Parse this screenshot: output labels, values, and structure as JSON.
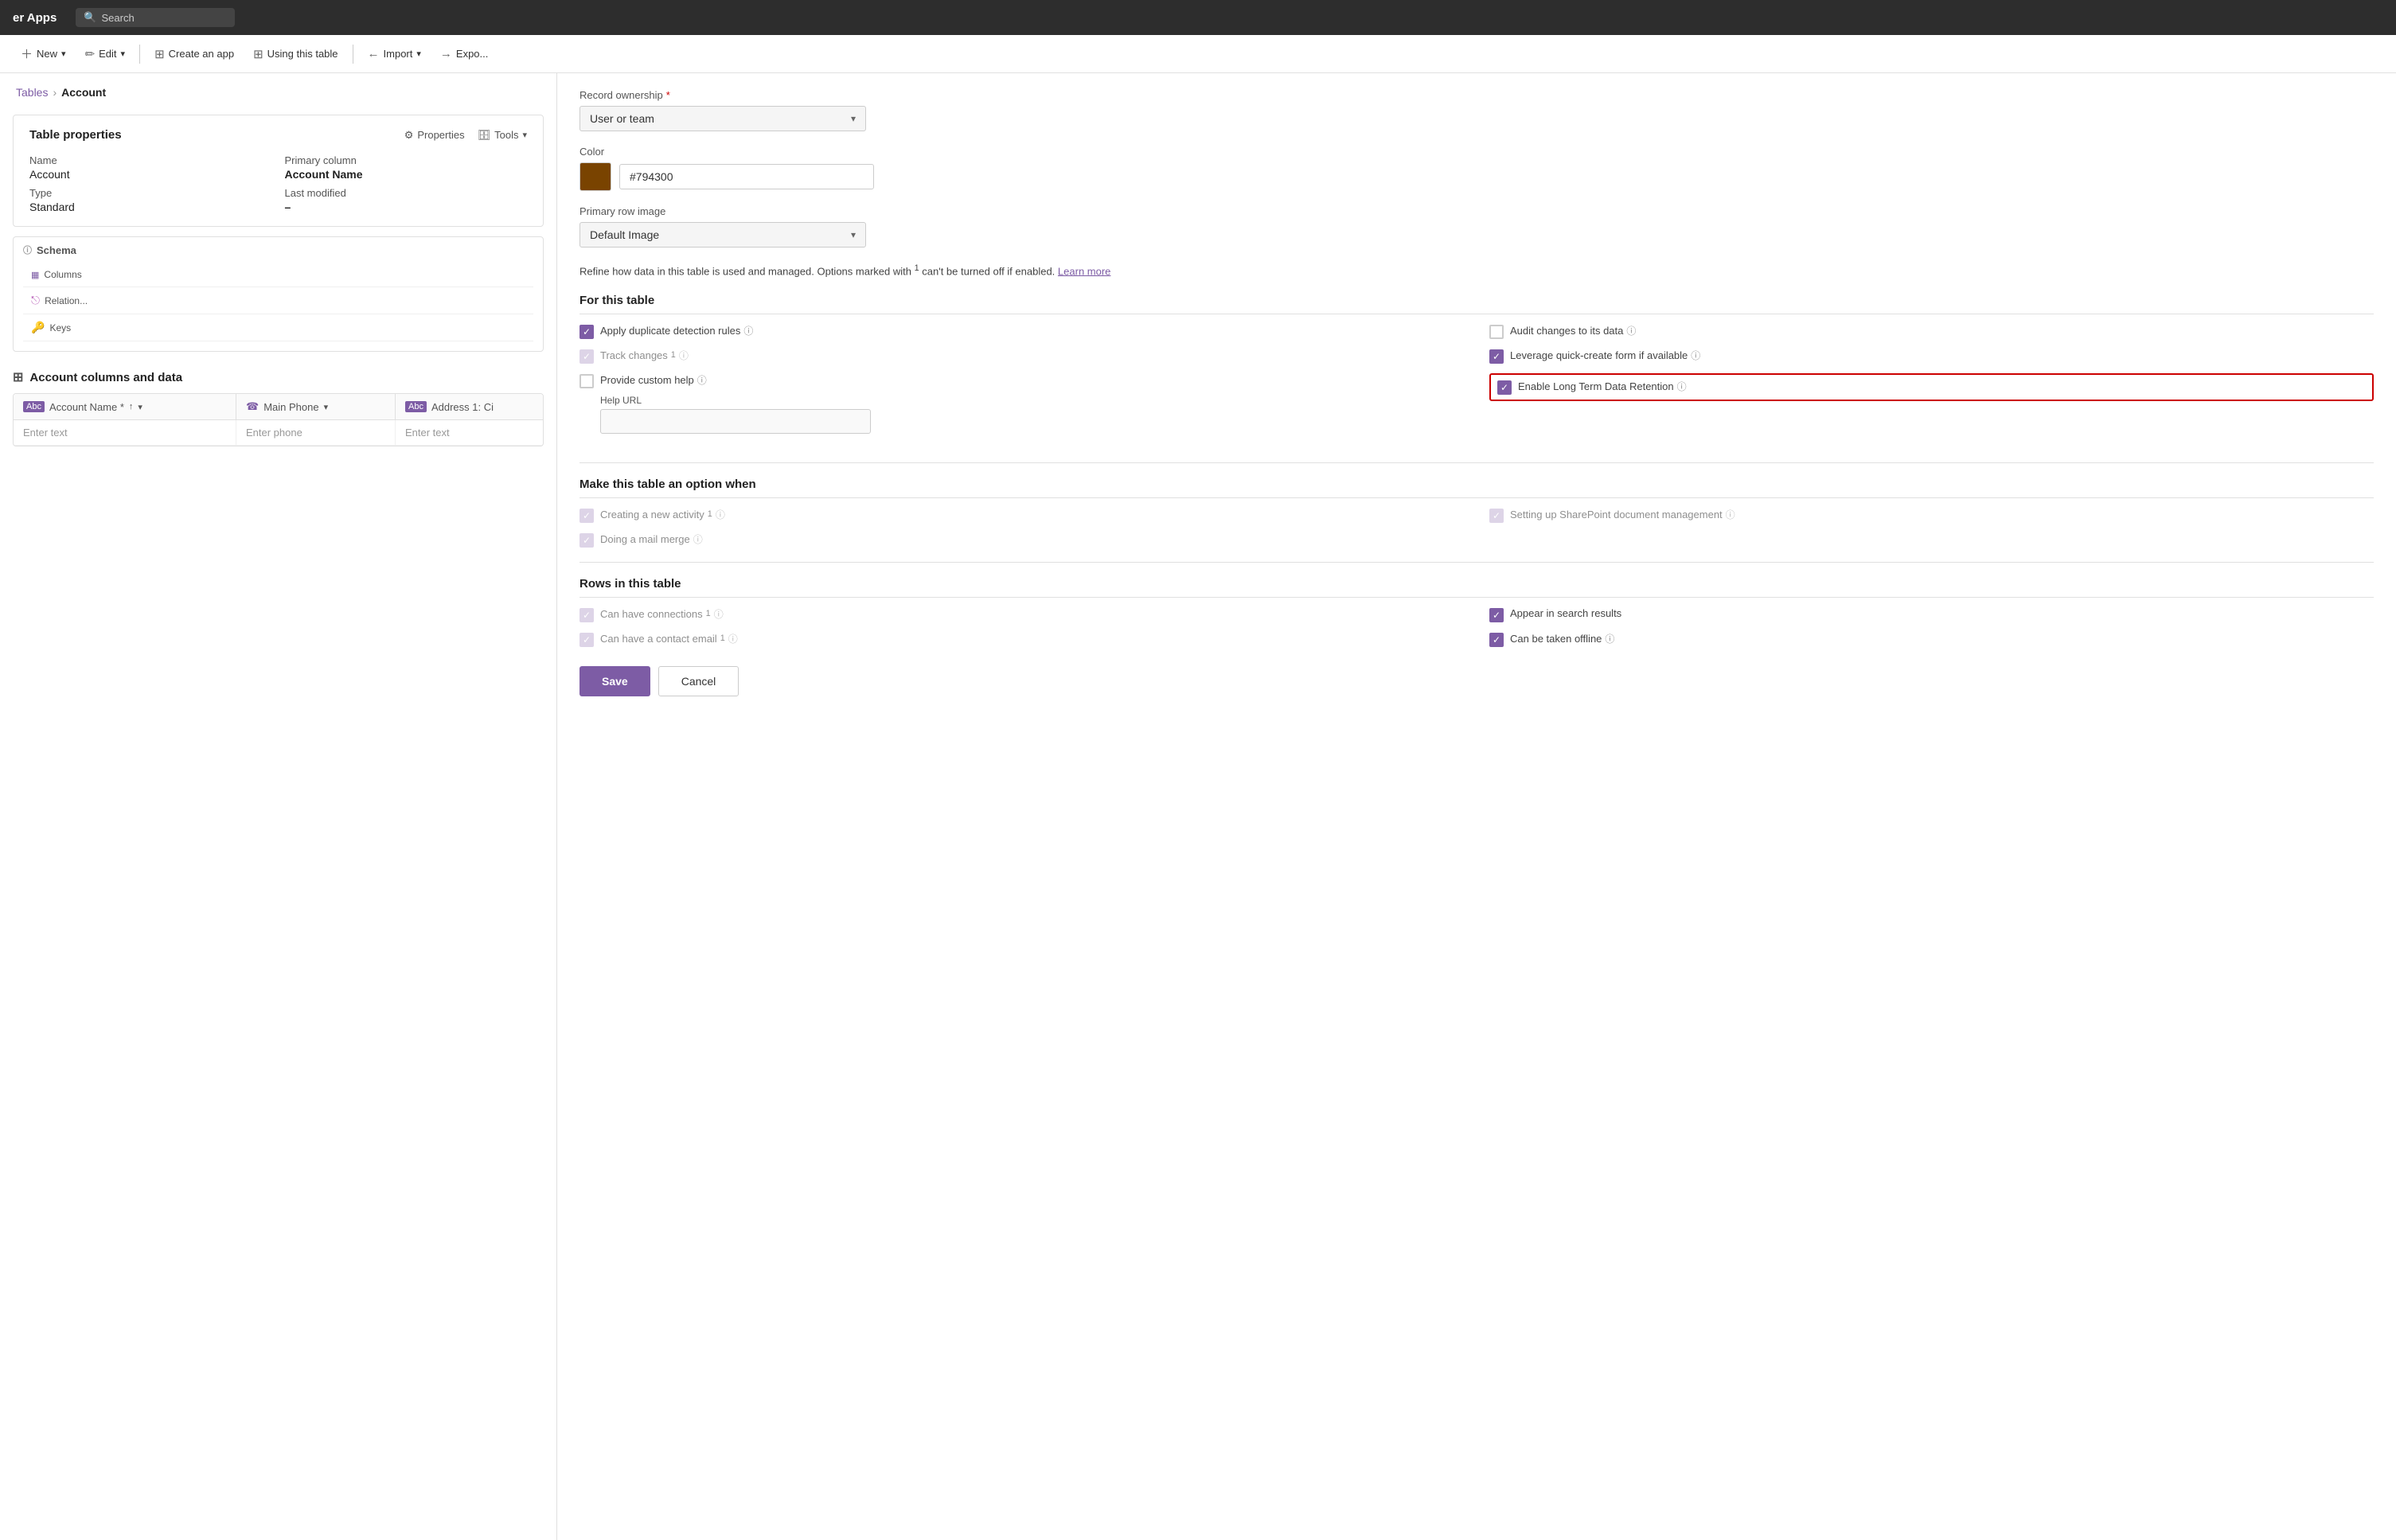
{
  "app": {
    "title": "er Apps",
    "search_placeholder": "Search"
  },
  "toolbar": {
    "new_label": "New",
    "edit_label": "Edit",
    "create_app_label": "Create an app",
    "using_table_label": "Using this table",
    "import_label": "Import",
    "export_label": "Expo..."
  },
  "breadcrumb": {
    "parent": "Tables",
    "separator": "›",
    "current": "Account"
  },
  "table_properties": {
    "title": "Table properties",
    "properties_btn": "Properties",
    "tools_btn": "Tools",
    "name_label": "Name",
    "name_value": "Account",
    "primary_col_label": "Primary column",
    "primary_col_value": "Account Name",
    "type_label": "Type",
    "type_value": "Standard",
    "last_modified_label": "Last modified",
    "last_modified_value": "–"
  },
  "schema": {
    "title": "Schema",
    "columns_label": "Columns",
    "relationships_label": "Relation...",
    "keys_label": "Keys"
  },
  "data_section": {
    "title": "Account columns and data",
    "columns": [
      {
        "icon": "Abc",
        "label": "Account Name",
        "required": true,
        "sort": true,
        "filter": true
      },
      {
        "icon": "☎",
        "label": "Main Phone",
        "filter": true
      },
      {
        "icon": "Abc",
        "label": "Address 1: Ci",
        "filter": false
      }
    ],
    "rows": [
      {
        "account_name_placeholder": "Enter text",
        "main_phone_placeholder": "Enter phone",
        "address_placeholder": "Enter text"
      }
    ]
  },
  "right_panel": {
    "record_ownership_label": "Record ownership",
    "record_ownership_required": true,
    "record_ownership_value": "User or team",
    "color_label": "Color",
    "color_value": "#794300",
    "color_hex": "#794300",
    "primary_row_image_label": "Primary row image",
    "primary_row_image_value": "Default Image",
    "refine_text": "Refine how data in this table is used and managed. Options marked with",
    "refine_superscript": "1",
    "refine_text2": "can't be turned off if enabled.",
    "learn_more": "Learn more",
    "for_this_table": {
      "title": "For this table",
      "checkboxes": [
        {
          "id": "apply_dup",
          "label": "Apply duplicate detection rules",
          "info": true,
          "checked": true,
          "disabled": false
        },
        {
          "id": "audit_changes",
          "label": "Audit changes to its data",
          "info": true,
          "checked": false,
          "disabled": false
        },
        {
          "id": "track_changes",
          "label": "Track changes",
          "superscript": "1",
          "info": true,
          "checked": true,
          "disabled": true
        },
        {
          "id": "leverage_quick",
          "label": "Leverage quick-create form if available",
          "info": true,
          "checked": true,
          "disabled": false
        },
        {
          "id": "provide_custom_help",
          "label": "Provide custom help",
          "info": true,
          "checked": false,
          "disabled": false
        },
        {
          "id": "enable_long_term",
          "label": "Enable Long Term Data Retention",
          "info": true,
          "checked": true,
          "disabled": false,
          "highlighted": true
        }
      ],
      "help_url_label": "Help URL",
      "help_url_placeholder": ""
    },
    "make_option_when": {
      "title": "Make this table an option when",
      "checkboxes": [
        {
          "id": "creating_activity",
          "label": "Creating a new activity",
          "superscript": "1",
          "info": true,
          "checked": true,
          "disabled": true
        },
        {
          "id": "sharepoint_doc",
          "label": "Setting up SharePoint document management",
          "info": true,
          "checked": true,
          "disabled": true
        },
        {
          "id": "mail_merge",
          "label": "Doing a mail merge",
          "info": true,
          "checked": true,
          "disabled": true
        }
      ]
    },
    "rows_in_table": {
      "title": "Rows in this table",
      "checkboxes": [
        {
          "id": "can_connections",
          "label": "Can have connections",
          "superscript": "1",
          "info": true,
          "checked": true,
          "disabled": true
        },
        {
          "id": "appear_search",
          "label": "Appear in search results",
          "info": false,
          "checked": true,
          "disabled": false
        },
        {
          "id": "can_contact_email",
          "label": "Can have a contact email",
          "superscript": "1",
          "info": true,
          "checked": true,
          "disabled": true
        },
        {
          "id": "can_taken_offline",
          "label": "Can be taken offline",
          "info": true,
          "checked": true,
          "disabled": false
        }
      ]
    },
    "save_label": "Save",
    "cancel_label": "Cancel"
  }
}
